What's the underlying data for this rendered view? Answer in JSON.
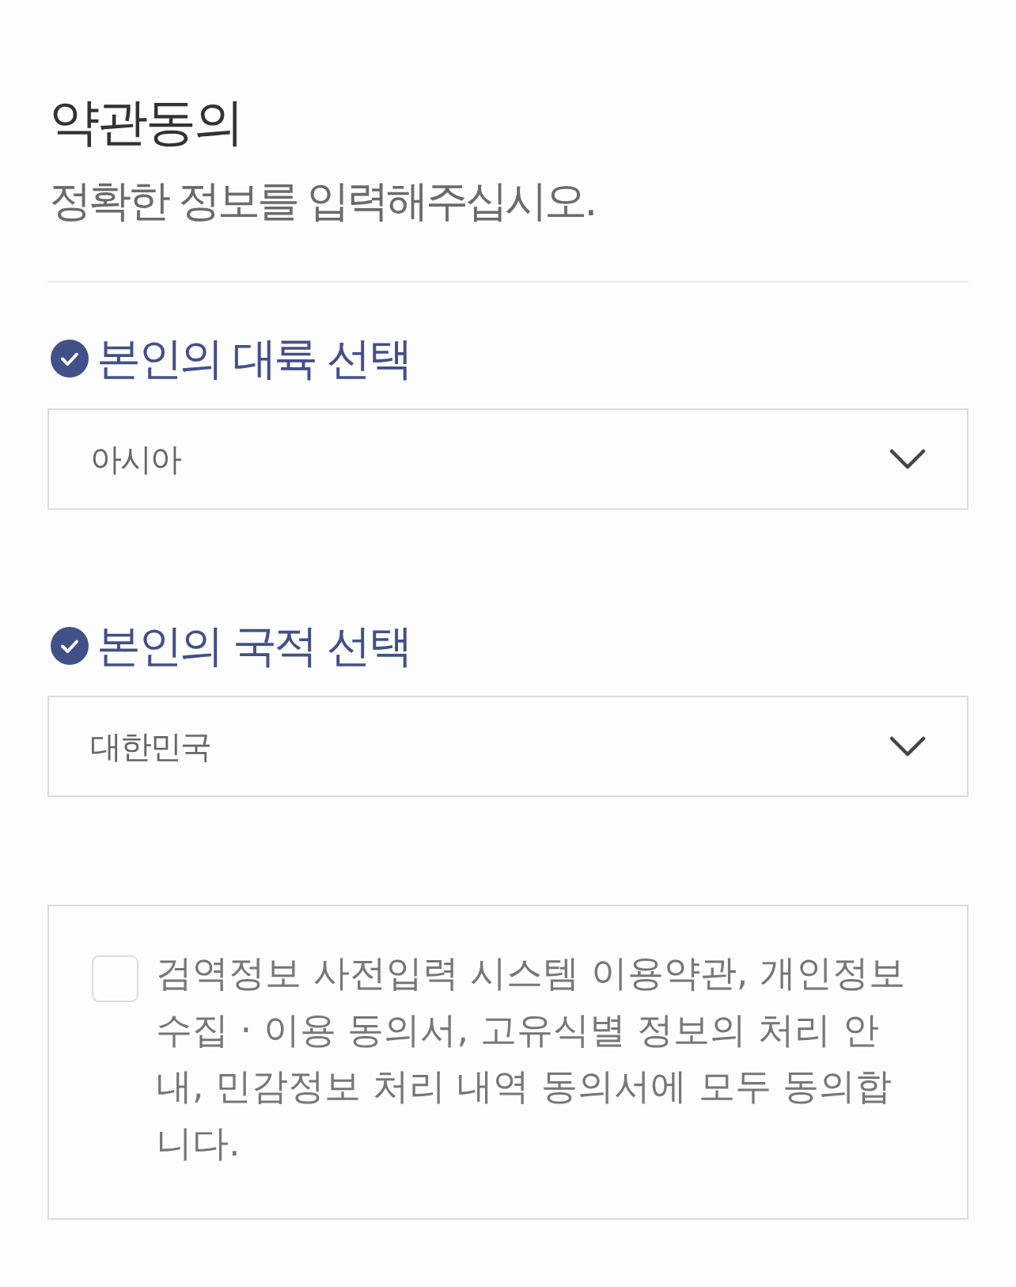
{
  "header": {
    "title": "약관동의",
    "subtitle": "정확한 정보를 입력해주십시오."
  },
  "fields": [
    {
      "label": "본인의 대륙 선택",
      "checked": true,
      "value": "아시아"
    },
    {
      "label": "본인의 국적 선택",
      "checked": true,
      "value": "대한민국"
    }
  ],
  "consent": {
    "checked": false,
    "text": "검역정보 사전입력 시스템 이용약관, 개인정보 수집 · 이용 동의서, 고유식별 정보의 처리 안내, 민감정보 처리 내역 동의서에 모두 동의합니다."
  }
}
